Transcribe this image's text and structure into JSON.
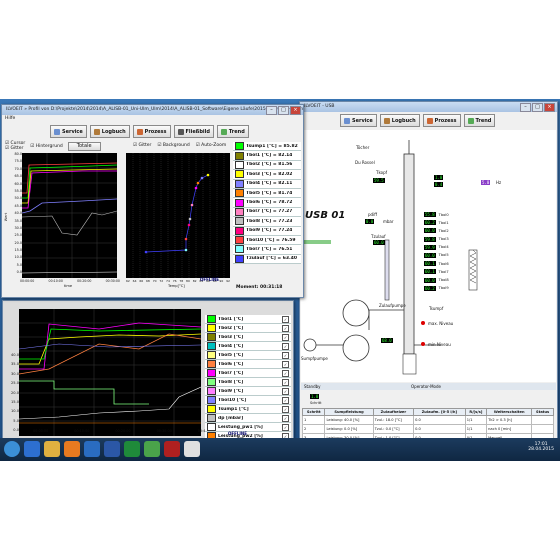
{
  "colors": {
    "plot_bg": "#000000",
    "grid": "#444444",
    "accent": "#1f4f86"
  },
  "front_window": {
    "title": "ILVOEIT » Profil von D:\\Projekte\\2014\\2014\\A_ALISB-01_Uni-Ulm_Ulm\\2014\\A_ALISB-01_Software\\Eigene Läufe\\2015-02-05_05-Ethanol-Wasse...",
    "menu": "Hilfe",
    "toolbar": [
      {
        "label": "Service",
        "icon": "wrench-icon"
      },
      {
        "label": "Logbuch",
        "icon": "book-icon"
      },
      {
        "label": "Prozess",
        "icon": "process-icon"
      },
      {
        "label": "Fließbild",
        "icon": "flowchart-icon"
      },
      {
        "label": "Trend",
        "icon": "trend-icon"
      }
    ],
    "left_controls": {
      "cursor": "Cursor",
      "grid": "Gitter",
      "background": "Hintergrund",
      "total": "Totale"
    },
    "mid_controls": {
      "grid": "Gitter",
      "background": "Background",
      "auto_zoom": "Auto-Zoom"
    },
    "left_plot": {
      "ylabel": "Wert",
      "xlabel": "time",
      "yticks": [
        "80.0",
        "75.0",
        "70.0",
        "65.0",
        "60.0",
        "55.0",
        "50.0",
        "45.0",
        "40.0",
        "35.0",
        "30.0",
        "25.0",
        "20.0",
        "15.0",
        "10.0",
        "5.0",
        "0.0"
      ],
      "xticks": [
        "00:00:00",
        "00:10:00",
        "00:20:00",
        "00:30:00"
      ]
    },
    "mid_plot": {
      "xlabel": "Temp[°C]",
      "xticks": [
        "62",
        "64",
        "66",
        "68",
        "70",
        "72",
        "74",
        "76",
        "78",
        "80",
        "82",
        "84",
        "86",
        "88",
        "90",
        "92"
      ]
    },
    "legend": [
      {
        "label": "Tsump1 [°C] = 85.82",
        "color": "#00ff00"
      },
      {
        "label": "Tbol1 [°C] = 82.14",
        "color": "#808000"
      },
      {
        "label": "Tbol2 [°C] = 81.56",
        "color": "#ffffff"
      },
      {
        "label": "Tbol3 [°C] = 82.02",
        "color": "#ffff00"
      },
      {
        "label": "Tbol4 [°C] = 82.11",
        "color": "#8080ff"
      },
      {
        "label": "Tbol5 [°C] = 81.74",
        "color": "#ff8000"
      },
      {
        "label": "Tbol6 [°C] = 78.72",
        "color": "#ff00ff"
      },
      {
        "label": "Tbol7 [°C] = 77.27",
        "color": "#ff80c0"
      },
      {
        "label": "Tbol8 [°C] = 77.23",
        "color": "#c0c0c0"
      },
      {
        "label": "Tbol9 [°C] = 77.24",
        "color": "#ff0080"
      },
      {
        "label": "Tbol10 [°C] = 76.59",
        "color": "#ff4040"
      },
      {
        "label": "Tbol7 [°C] = 76.51",
        "color": "#80ffff"
      },
      {
        "label": "Tzulauf [°C] = 63.40",
        "color": "#4040ff"
      }
    ],
    "offline": "OFFLINE",
    "moment": "Moment: 00:31:18"
  },
  "back_trend": {
    "legend": [
      {
        "label": "Tbol1 [°C]",
        "color": "#00ff00"
      },
      {
        "label": "Tbol2 [°C]",
        "color": "#ffff00"
      },
      {
        "label": "Tbol3 [°C]",
        "color": "#808000"
      },
      {
        "label": "Tbol4 [°C]",
        "color": "#00c0c0"
      },
      {
        "label": "Tbol5 [°C]",
        "color": "#ffff80"
      },
      {
        "label": "Tbol6 [°C]",
        "color": "#ff8040"
      },
      {
        "label": "Tbol7 [°C]",
        "color": "#ff00ff"
      },
      {
        "label": "Tbol8 [°C]",
        "color": "#80ff80"
      },
      {
        "label": "Tbol9 [°C]",
        "color": "#ff80ff"
      },
      {
        "label": "Tbol10 [°C]",
        "color": "#8080ff"
      },
      {
        "label": "Tsump1 [°C]",
        "color": "#ffff00"
      },
      {
        "label": "dp [mbar]",
        "color": "#c0c0c0"
      },
      {
        "label": "Leistung_pw1 [%]",
        "color": "#ffffff"
      },
      {
        "label": "Leistung_pw2 [%]",
        "color": "#ff8000"
      }
    ],
    "yticks": [
      "40.0",
      "35.0",
      "30.0",
      "25.0",
      "20.0",
      "15.0",
      "10.0",
      "5.0",
      "0.0"
    ],
    "xticks": [
      "00:00:00",
      "00:10:00",
      "00:20:00",
      "00:30:00",
      "00:40:00"
    ],
    "xlabel": "Zeit",
    "offline": "OFFLINE"
  },
  "right_window": {
    "title": "ILVOEIT - USB",
    "toolbar": [
      "Service",
      "Logbuch",
      "Prozess",
      "Trend"
    ],
    "plant_label": "USB 01",
    "labels": {
      "toeleer": "Töcher",
      "du_rossel": "Du Rossel",
      "tkopf": "Tkopf",
      "pdiff": "pdiff",
      "mbar": "mbar",
      "tzulauf": "Tzulauf",
      "zulaufpumpe": "Zulaufpumpe",
      "sumpfpumpe": "Sumpfpumpe",
      "tsumpf": "Tsumpf",
      "max_niveau": "max. Niveau",
      "min_niveau": "min Niveau",
      "ruecklauf": "Rücklaufteiler",
      "frequency": "Hz",
      "standby": "Standby",
      "operator": "Operator-Mode"
    },
    "values": {
      "kopf": "59.5",
      "tzulauf": "60.0",
      "sumpf": "68.0",
      "freq": "5.0",
      "vent1": "1.0",
      "vent2": "0.4",
      "kw": "0.0",
      "side1": "0.0",
      "side2": "0.0",
      "bottom_val": "1.0"
    },
    "tbol_values": [
      "55.8",
      "60.2",
      "60.0",
      "59.8",
      "59.9",
      "60.0",
      "60.1",
      "60.1",
      "60.0",
      "60.2"
    ],
    "tbol_labels": [
      "Tbol0",
      "Tbol1",
      "Tbol2",
      "Tbol3",
      "Tbol4",
      "Tbol5",
      "Tbol6",
      "Tbol7",
      "Tbol8",
      "Tbol9"
    ],
    "step_small": {
      "value": "1.0",
      "label": "Schritt"
    },
    "table": {
      "headers": [
        "Schritt",
        "Sumpfleistung",
        "Zulaufheizer",
        "Zulaufm. [0-5 l/h]",
        "R/[s/s]",
        "Weiterschalten",
        "Status"
      ],
      "rows": [
        [
          "1",
          "Leistung: 40.0 [%]",
          "Tzul.: 18.0 [°C]",
          "0.0",
          "1/1",
          "Tk2 > 0.3 [h]",
          ""
        ],
        [
          "2",
          "Leistung: 0.0 [%]",
          "Tzul.: 0.0 [°C]",
          "0.0",
          "1/1",
          "nach 0 [min]",
          ""
        ],
        [
          "3",
          "Leistung: 30.0 [%]",
          "Tzul.: 1.0 [°C]",
          "0.0",
          "0/1",
          "Manuell",
          ""
        ]
      ]
    }
  },
  "taskbar": {
    "time": "17:01",
    "date": "28.04.2015",
    "apps": [
      "start-orb",
      "ie",
      "explorer",
      "firefox",
      "outlook",
      "word",
      "excel",
      "app-green",
      "app-x",
      "app-white"
    ]
  }
}
